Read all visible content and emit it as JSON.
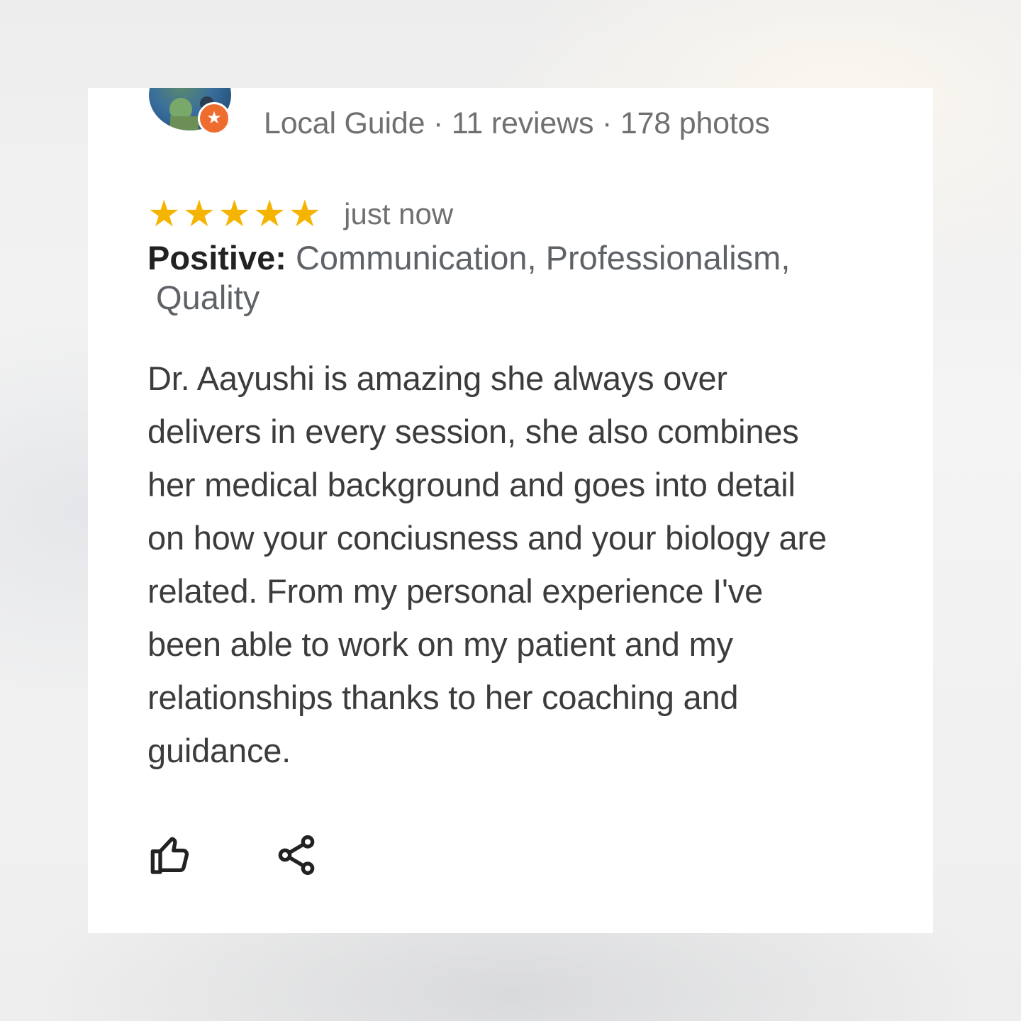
{
  "reviewer": {
    "meta": "Local Guide · 11 reviews · 178 photos",
    "avatar_icon": "avatar-photo",
    "badge_icon": "local-guide-star-icon",
    "badge_color": "#ef6c2f"
  },
  "rating": {
    "stars": 5,
    "max_stars": 5,
    "star_color": "#f5b400",
    "time": "just now"
  },
  "highlights": {
    "label": "Positive:",
    "line1": "Communication, Professionalism,",
    "line2": "Quality"
  },
  "review_text": {
    "lines": [
      "Dr. Aayushi is amazing she always over",
      "delivers in every session, she also combines",
      "her medical background and goes into detail",
      "on how your conciusness and your biology are",
      "related. From my personal experience I've",
      "been able to work on my patient and my",
      "relationships thanks to her coaching and",
      "guidance."
    ]
  },
  "actions": {
    "like_icon": "thumbs-up-icon",
    "share_icon": "share-icon"
  }
}
